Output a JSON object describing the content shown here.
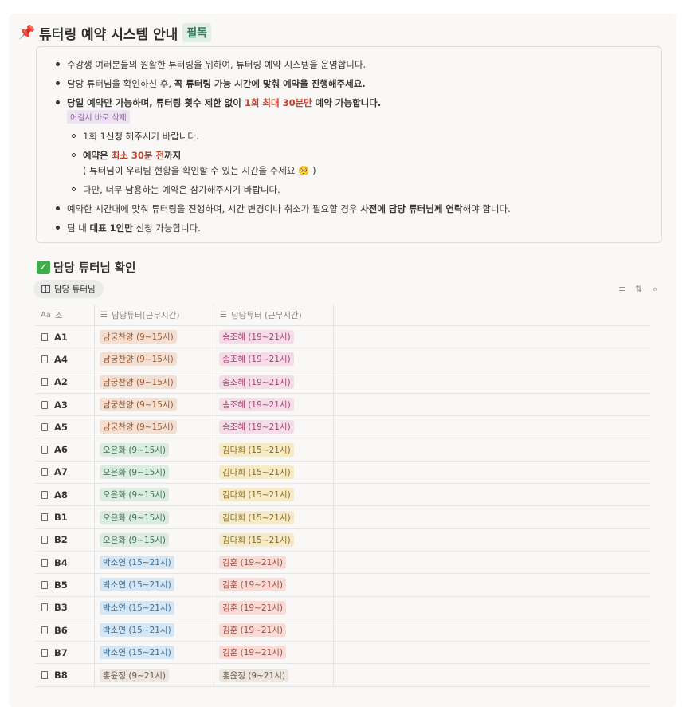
{
  "header": {
    "title": "튜터링 예약 시스템 안내",
    "badge": "필독"
  },
  "notice": {
    "l1": "수강생 여러분들의 원활한 튜터링을 위하여, 튜터링 예약 시스템을 운영합니다.",
    "l2a": "담당 튜터님을 확인하신 후, ",
    "l2b": "꼭 튜터링 가능 시간에 맞춰 예약을 진행해주세요.",
    "l3a": "당일 예약만 가능하며, 튜터링 횟수 제한 없이 ",
    "l3red": "1회 최대 30분만",
    "l3b": " 예약 가능합니다.",
    "warn_tag": "어길시 바로 삭제",
    "s1": "1회 1신청 해주시기 바랍니다.",
    "s2a": "예약은 ",
    "s2red": "최소 30분 전",
    "s2b": "까지",
    "s2c": "( 튜터님이 우리팀 현황을 확인할 수 있는 시간을 주세요 🥺 )",
    "s3": "다만, 너무 남용하는 예약은 삼가해주시기 바랍니다.",
    "l4a": "예약한 시간대에 맞춰 튜터링을 진행하며, 시간 변경이나 취소가 필요할 경우 ",
    "l4b": "사전에 담당 튜터님께 연락",
    "l4c": "해야 합니다.",
    "l5a": "팀 내 ",
    "l5b": "대표 1인만",
    "l5c": " 신청 가능합니다."
  },
  "section": {
    "title": "담당 튜터님 확인",
    "view_tab": "담당 튜터님"
  },
  "table": {
    "col_group": "조",
    "col_group_icon": "Aa",
    "col_tutor1": "담당튜터(근무시간)",
    "col_tutor2": "담당튜터 (근무시간)",
    "rows": [
      {
        "group": "A1",
        "t1": "남궁찬양 (9~15시)",
        "t2": "송조혜 (19~21시)"
      },
      {
        "group": "A4",
        "t1": "남궁찬양 (9~15시)",
        "t2": "송조혜 (19~21시)"
      },
      {
        "group": "A2",
        "t1": "남궁찬양 (9~15시)",
        "t2": "송조혜 (19~21시)"
      },
      {
        "group": "A3",
        "t1": "남궁찬양 (9~15시)",
        "t2": "송조혜 (19~21시)"
      },
      {
        "group": "A5",
        "t1": "남궁찬양 (9~15시)",
        "t2": "송조혜 (19~21시)"
      },
      {
        "group": "A6",
        "t1": "오은화 (9~15시)",
        "t2": "김다희 (15~21시)"
      },
      {
        "group": "A7",
        "t1": "오은화 (9~15시)",
        "t2": "김다희 (15~21시)"
      },
      {
        "group": "A8",
        "t1": "오은화 (9~15시)",
        "t2": "김다희 (15~21시)"
      },
      {
        "group": "B1",
        "t1": "오은화 (9~15시)",
        "t2": "김다희 (15~21시)"
      },
      {
        "group": "B2",
        "t1": "오은화 (9~15시)",
        "t2": "김다희 (15~21시)"
      },
      {
        "group": "B4",
        "t1": "박소연 (15~21시)",
        "t2": "김훈 (19~21시)"
      },
      {
        "group": "B5",
        "t1": "박소연 (15~21시)",
        "t2": "김훈 (19~21시)"
      },
      {
        "group": "B3",
        "t1": "박소연 (15~21시)",
        "t2": "김훈 (19~21시)"
      },
      {
        "group": "B6",
        "t1": "박소연 (15~21시)",
        "t2": "김훈 (19~21시)"
      },
      {
        "group": "B7",
        "t1": "박소연 (15~21시)",
        "t2": "김훈 (19~21시)"
      },
      {
        "group": "B8",
        "t1": "홍윤정 (9~21시)",
        "t2": "홍윤정 (9~21시)"
      }
    ]
  },
  "tag_colors": {
    "남궁찬양 (9~15시)": {
      "bg": "#f4e0d3",
      "fg": "#9a5a33"
    },
    "오은화 (9~15시)": {
      "bg": "#dcece2",
      "fg": "#3f7250"
    },
    "박소연 (15~21시)": {
      "bg": "#d6e6f3",
      "fg": "#3c6f98"
    },
    "홍윤정 (9~21시)": {
      "bg": "#ece6e0",
      "fg": "#6d5a4b"
    },
    "송조혜 (19~21시)": {
      "bg": "#f5dde8",
      "fg": "#a2466f"
    },
    "김다희 (15~21시)": {
      "bg": "#f6ebc9",
      "fg": "#8a6a1c"
    },
    "김훈 (19~21시)": {
      "bg": "#f8dcd8",
      "fg": "#a84838"
    }
  }
}
